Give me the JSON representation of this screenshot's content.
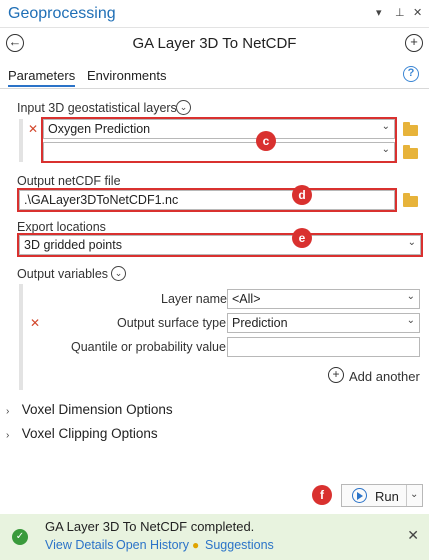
{
  "pane": {
    "title": "Geoprocessing",
    "menu_glyph": "▾",
    "pin_glyph": "⊥",
    "close_glyph": "✕"
  },
  "tool": {
    "title": "GA Layer 3D To NetCDF",
    "back_glyph": "←",
    "add_glyph": "+"
  },
  "tabs": [
    {
      "label": "Parameters",
      "active": true
    },
    {
      "label": "Environments",
      "active": false
    }
  ],
  "help_glyph": "?",
  "params": {
    "input_layers": {
      "label": "Input 3D geostatistical layers",
      "rows": [
        {
          "value": "Oxygen Prediction",
          "has_error": true
        },
        {
          "value": "",
          "has_error": false
        }
      ]
    },
    "output_file": {
      "label": "Output netCDF file",
      "value": ".\\GALayer3DToNetCDF1.nc"
    },
    "export_locations": {
      "label": "Export locations",
      "value": "3D gridded points"
    },
    "output_variables": {
      "label": "Output variables",
      "layer_name_label": "Layer name",
      "layer_name_value": "<All>",
      "surface_type_label": "Output surface type",
      "surface_type_value": "Prediction",
      "quantile_label": "Quantile or probability value",
      "quantile_value": "",
      "add_another": "Add another"
    }
  },
  "sections": [
    {
      "label": "Voxel Dimension Options"
    },
    {
      "label": "Voxel Clipping Options"
    }
  ],
  "callouts": {
    "c": "c",
    "d": "d",
    "e": "e",
    "f": "f"
  },
  "run": {
    "label": "Run"
  },
  "status": {
    "message": "GA Layer 3D To NetCDF completed.",
    "view_details": "View Details",
    "open_history": "Open History",
    "suggestions": "Suggestions"
  },
  "glyphs": {
    "dropdown": "⌄",
    "error_x": "✕",
    "expand": "⌄",
    "chevron_right": "›",
    "check": "✓"
  },
  "colors": {
    "accent": "#2b73c8",
    "callout": "#d9312f",
    "error": "#d2472c",
    "success_bg": "#e8f3df",
    "success_icon": "#3a9a3c",
    "folder": "#e7b33a"
  },
  "icons": [
    "back-icon",
    "add-icon",
    "help-icon",
    "folder-icon",
    "play-icon",
    "success-icon",
    "close-icon",
    "lightbulb-icon",
    "plus-circle-icon"
  ]
}
